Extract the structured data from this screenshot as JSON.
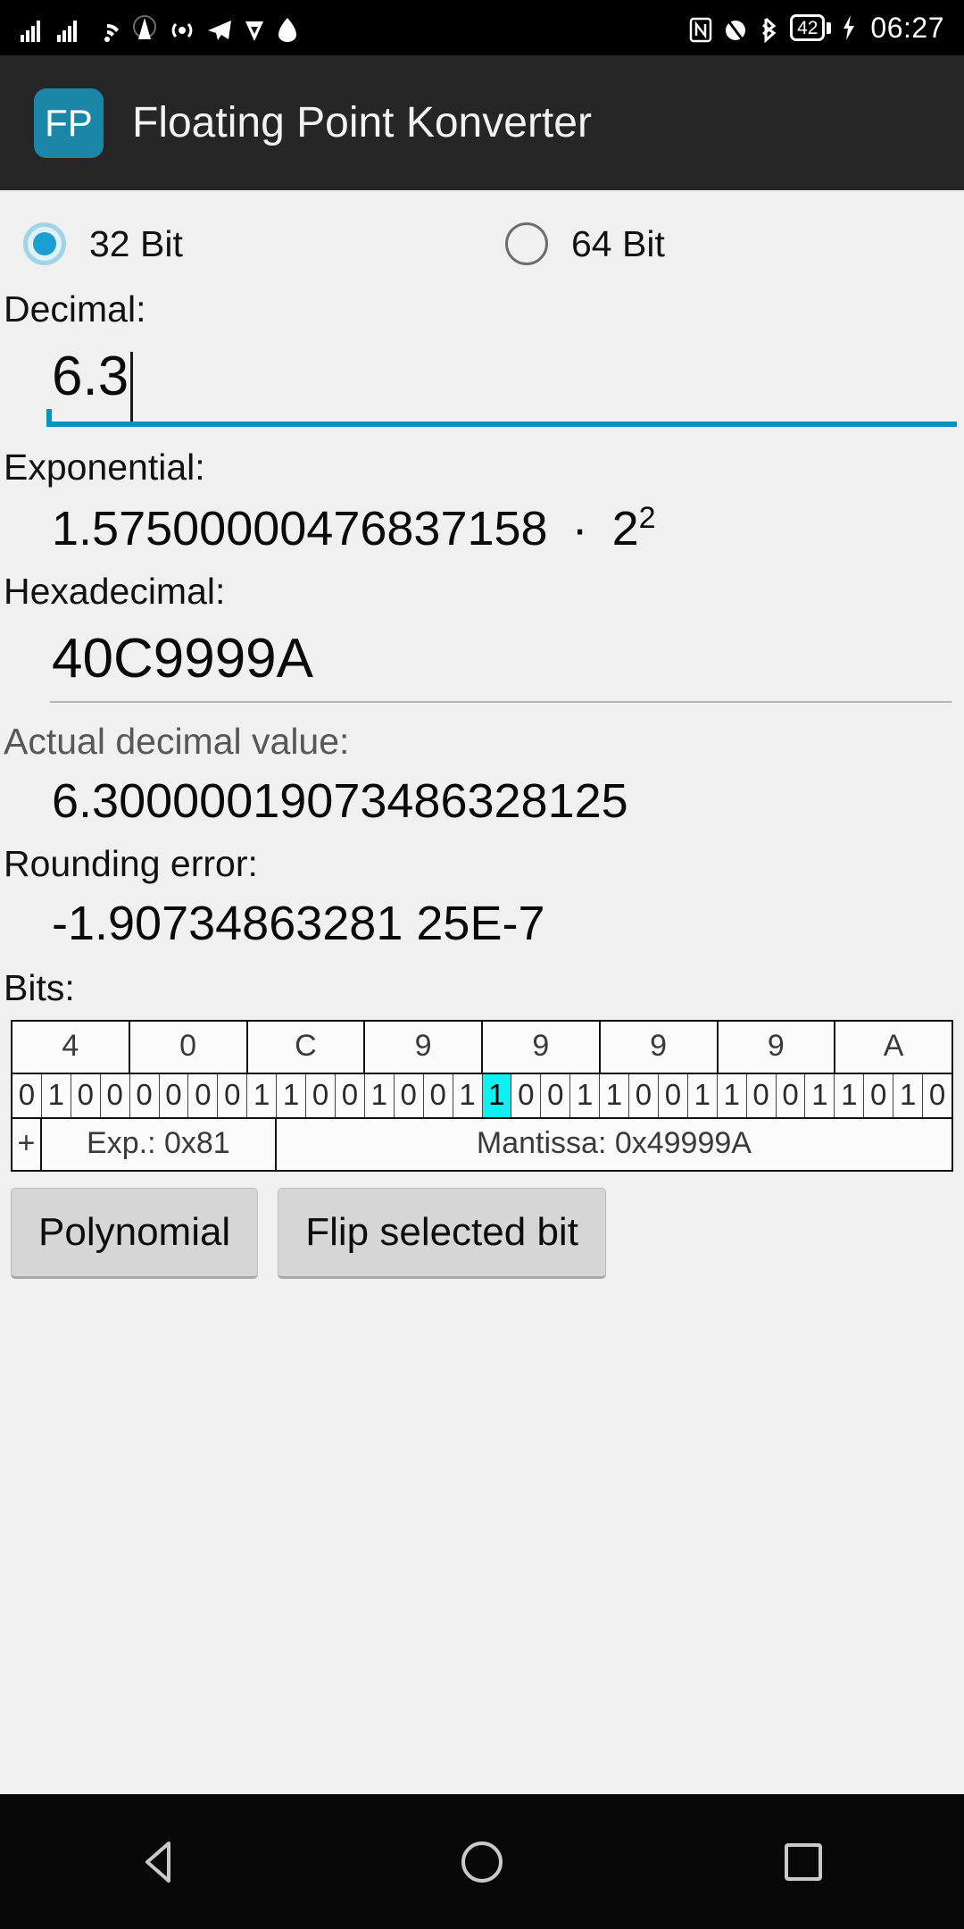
{
  "statusbar": {
    "left_icons": [
      "signal-bars-icon",
      "signal-bars-icon",
      "wifi-icon",
      "cell-tower-icon",
      "hotspot-icon",
      "telegram-icon",
      "app-icon",
      "app-icon"
    ],
    "right_icons": [
      "nfc-icon",
      "alarm-off-icon",
      "bluetooth-icon"
    ],
    "battery_level": "42",
    "charging_icon": "lightning-bolt-icon",
    "time": "06:27"
  },
  "appbar": {
    "logo_text": "FP",
    "logo_color": "#1b87a8",
    "title": "Floating Point Konverter"
  },
  "precision": {
    "options": [
      {
        "label": "32 Bit",
        "selected": true
      },
      {
        "label": "64 Bit",
        "selected": false
      }
    ],
    "accent_color": "#1b9fd0"
  },
  "decimal": {
    "label": "Decimal:",
    "value": "6.3",
    "placeholder": "",
    "underline_color": "#0a93bd"
  },
  "exponential": {
    "label": "Exponential:",
    "mantissa": "1.57500000476837158",
    "operator": "·",
    "base": "2",
    "exponent": "2"
  },
  "hexadecimal": {
    "label": "Hexadecimal:",
    "value": "40C9999A",
    "placeholder": ""
  },
  "actual_value": {
    "label": "Actual decimal value:",
    "value": "6.30000019073486328125"
  },
  "rounding_error": {
    "label": "Rounding error:",
    "value": "-1.90734863281 25E-7"
  },
  "bits": {
    "label": "Bits:",
    "hex_nibbles": [
      "4",
      "0",
      "C",
      "9",
      "9",
      "9",
      "9",
      "A"
    ],
    "bit_values": [
      "0",
      "1",
      "0",
      "0",
      "0",
      "0",
      "0",
      "0",
      "1",
      "1",
      "0",
      "0",
      "1",
      "0",
      "0",
      "1",
      "1",
      "0",
      "0",
      "1",
      "1",
      "0",
      "0",
      "1",
      "1",
      "0",
      "0",
      "1",
      "1",
      "0",
      "1",
      "0"
    ],
    "selected_bit_index": 16,
    "selected_color": "#0ff0f0",
    "sign_label": "+",
    "exponent_label": "Exp.: 0x81",
    "mantissa_label": "Mantissa: 0x49999A"
  },
  "buttons": {
    "polynomial": "Polynomial",
    "flip_bit": "Flip selected bit"
  },
  "navbar": {
    "back": "back-triangle-icon",
    "home": "home-circle-icon",
    "recents": "recents-square-icon"
  }
}
